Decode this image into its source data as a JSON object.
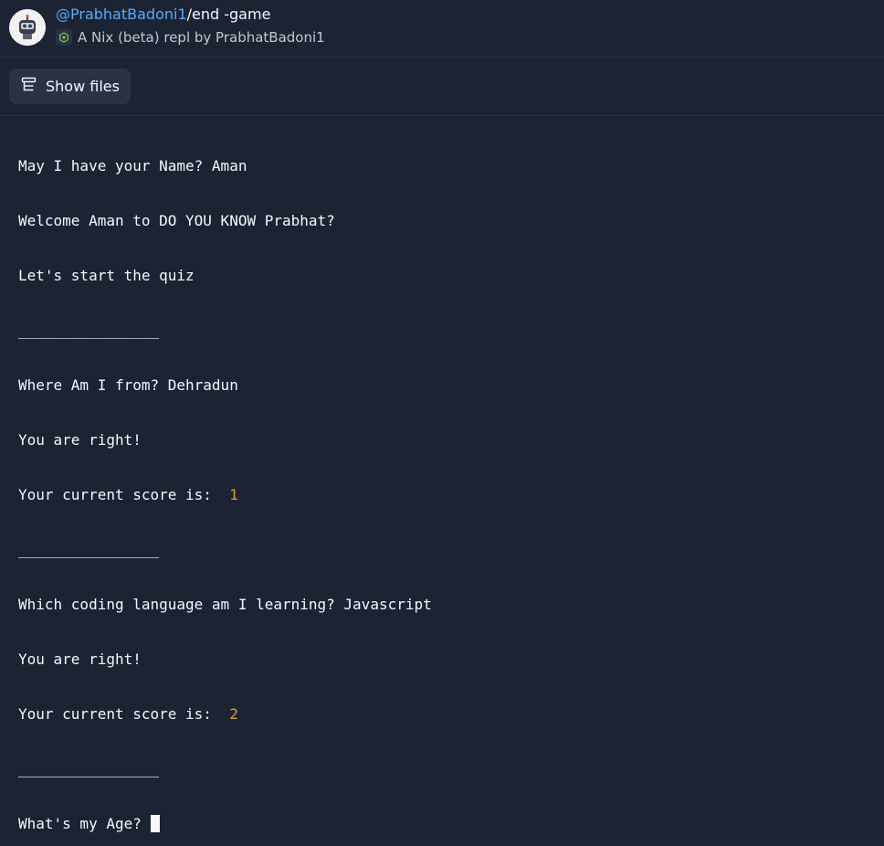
{
  "header": {
    "owner": "@PrabhatBadoni1",
    "repl_name": "/end -game",
    "subtitle": "A Nix (beta) repl by PrabhatBadoni1",
    "avatar_icon": "robot-avatar-icon",
    "badge_icon": "nix-icon"
  },
  "toolbar": {
    "show_files_label": "Show files",
    "show_files_icon": "files-icon"
  },
  "console": {
    "lines": [
      "May I have your Name? Aman",
      "Welcome Aman to DO YOU KNOW Prabhat?",
      "Let's start the quiz",
      "________________",
      "Where Am I from? Dehradun",
      "You are right!",
      "Your current score is:  ",
      "________________",
      "Which coding language am I learning? Javascript",
      "You are right!",
      "Your current score is:  ",
      "________________",
      "What's my Age? "
    ],
    "score_1": "1",
    "score_2": "2"
  },
  "colors": {
    "background": "#1c2333",
    "link": "#57abff",
    "text": "#f5f9fc",
    "score": "#d4a23c",
    "button_bg": "#2b3245"
  }
}
